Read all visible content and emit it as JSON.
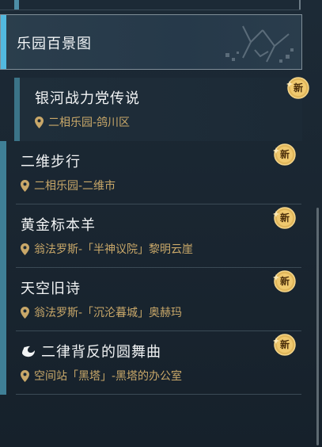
{
  "category": {
    "title": "乐园百景图"
  },
  "badge_text": "新",
  "entries": [
    {
      "name": "银河战力党传说",
      "location": "二相乐园-鸽川区"
    },
    {
      "name": "二维步行",
      "location": "二相乐园-二维市"
    },
    {
      "name": "黄金标本羊",
      "location": "翁法罗斯-「半神议院」黎明云崖"
    },
    {
      "name": "天空旧诗",
      "location": "翁法罗斯-「沉沦暮城」奥赫玛"
    },
    {
      "name": "二律背反的圆舞曲",
      "location": "空间站「黑塔」-黑塔的办公室",
      "icon": "quest-icon"
    }
  ],
  "colors": {
    "accent_blue": "#52b9df",
    "location_gold": "#c9a869",
    "badge_gold": "#e0b65a"
  }
}
